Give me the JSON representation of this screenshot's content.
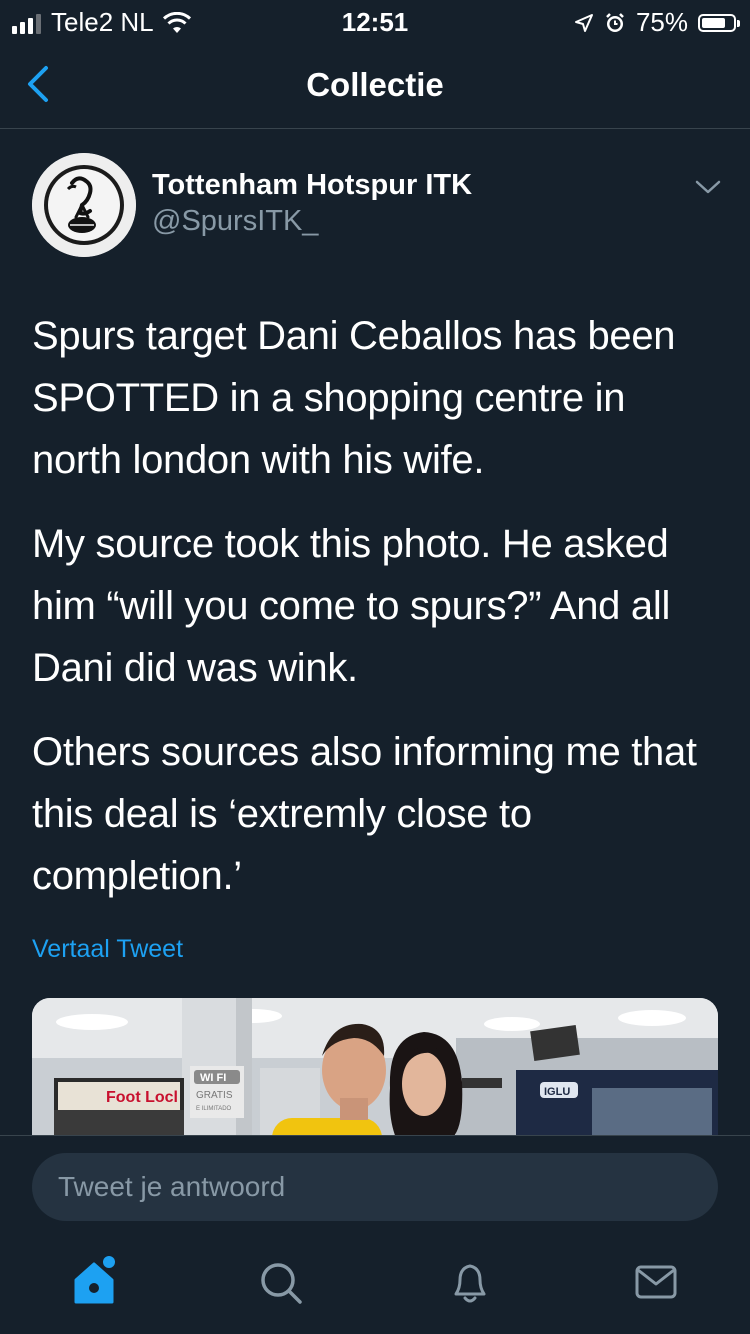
{
  "status_bar": {
    "carrier": "Tele2 NL",
    "time": "12:51",
    "battery_percent": "75%",
    "battery_level": 0.75
  },
  "nav": {
    "back_icon": "chevron-left-icon",
    "title": "Collectie"
  },
  "tweet": {
    "author_name": "Tottenham Hotspur ITK",
    "author_handle": "@SpursITK_",
    "paragraphs": [
      "Spurs target Dani Ceballos has been SPOTTED in a shopping centre in north london with his wife.",
      "My source took this photo. He asked him “will you come to spurs?” And all Dani did was wink.",
      "Others sources also informing me that this deal is ‘extremly close to completion.’"
    ],
    "translate_label": "Vertaal Tweet",
    "photo_signs": {
      "store_sign": "Foot Locl",
      "wifi_label": "WI FI",
      "wifi_sub": "GRATIS",
      "wifi_sub2": "E ILIMITADO",
      "shop_logo": "IGLU"
    }
  },
  "reply": {
    "placeholder": "Tweet je antwoord"
  },
  "tab_bar": {
    "tabs": [
      {
        "icon": "home-icon",
        "active": true
      },
      {
        "icon": "search-icon",
        "active": false
      },
      {
        "icon": "bell-icon",
        "active": false
      },
      {
        "icon": "mail-icon",
        "active": false
      }
    ]
  },
  "colors": {
    "background": "#15202b",
    "accent": "#1da1f2",
    "secondary_text": "#8899a6",
    "divider": "#38444d"
  }
}
